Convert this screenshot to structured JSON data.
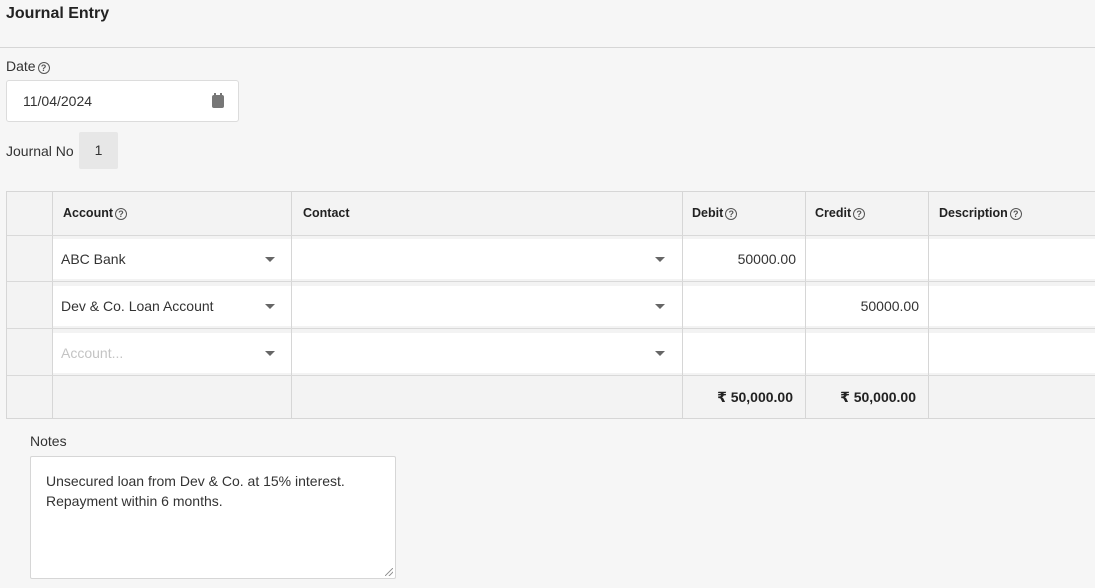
{
  "page": {
    "title": "Journal Entry"
  },
  "date": {
    "label": "Date",
    "value": "11/04/2024"
  },
  "journal_no": {
    "label": "Journal No",
    "value": "1"
  },
  "table": {
    "headers": {
      "account": "Account",
      "contact": "Contact",
      "debit": "Debit",
      "credit": "Credit",
      "description": "Description"
    },
    "rows": [
      {
        "account": "ABC Bank",
        "contact": "",
        "debit": "50000.00",
        "credit": "",
        "description": ""
      },
      {
        "account": "Dev & Co. Loan Account",
        "contact": "",
        "debit": "",
        "credit": "50000.00",
        "description": ""
      }
    ],
    "new_row": {
      "account_placeholder": "Account..."
    },
    "totals": {
      "debit": "₹ 50,000.00",
      "credit": "₹ 50,000.00"
    }
  },
  "notes": {
    "label": "Notes",
    "value": "Unsecured loan from Dev & Co. at 15% interest.\nRepayment within 6 months."
  },
  "icons": {
    "help": "?"
  }
}
